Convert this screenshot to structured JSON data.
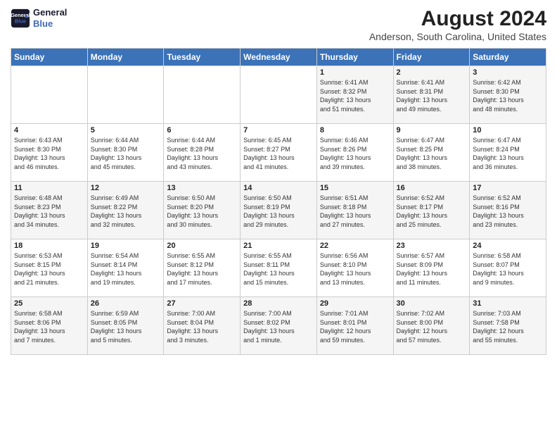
{
  "header": {
    "logo_line1": "General",
    "logo_line2": "Blue",
    "title": "August 2024",
    "subtitle": "Anderson, South Carolina, United States"
  },
  "days_of_week": [
    "Sunday",
    "Monday",
    "Tuesday",
    "Wednesday",
    "Thursday",
    "Friday",
    "Saturday"
  ],
  "weeks": [
    [
      {
        "day": "",
        "info": ""
      },
      {
        "day": "",
        "info": ""
      },
      {
        "day": "",
        "info": ""
      },
      {
        "day": "",
        "info": ""
      },
      {
        "day": "1",
        "info": "Sunrise: 6:41 AM\nSunset: 8:32 PM\nDaylight: 13 hours\nand 51 minutes."
      },
      {
        "day": "2",
        "info": "Sunrise: 6:41 AM\nSunset: 8:31 PM\nDaylight: 13 hours\nand 49 minutes."
      },
      {
        "day": "3",
        "info": "Sunrise: 6:42 AM\nSunset: 8:30 PM\nDaylight: 13 hours\nand 48 minutes."
      }
    ],
    [
      {
        "day": "4",
        "info": "Sunrise: 6:43 AM\nSunset: 8:30 PM\nDaylight: 13 hours\nand 46 minutes."
      },
      {
        "day": "5",
        "info": "Sunrise: 6:44 AM\nSunset: 8:30 PM\nDaylight: 13 hours\nand 45 minutes."
      },
      {
        "day": "6",
        "info": "Sunrise: 6:44 AM\nSunset: 8:28 PM\nDaylight: 13 hours\nand 43 minutes."
      },
      {
        "day": "7",
        "info": "Sunrise: 6:45 AM\nSunset: 8:27 PM\nDaylight: 13 hours\nand 41 minutes."
      },
      {
        "day": "8",
        "info": "Sunrise: 6:46 AM\nSunset: 8:26 PM\nDaylight: 13 hours\nand 39 minutes."
      },
      {
        "day": "9",
        "info": "Sunrise: 6:47 AM\nSunset: 8:25 PM\nDaylight: 13 hours\nand 38 minutes."
      },
      {
        "day": "10",
        "info": "Sunrise: 6:47 AM\nSunset: 8:24 PM\nDaylight: 13 hours\nand 36 minutes."
      }
    ],
    [
      {
        "day": "11",
        "info": "Sunrise: 6:48 AM\nSunset: 8:23 PM\nDaylight: 13 hours\nand 34 minutes."
      },
      {
        "day": "12",
        "info": "Sunrise: 6:49 AM\nSunset: 8:22 PM\nDaylight: 13 hours\nand 32 minutes."
      },
      {
        "day": "13",
        "info": "Sunrise: 6:50 AM\nSunset: 8:20 PM\nDaylight: 13 hours\nand 30 minutes."
      },
      {
        "day": "14",
        "info": "Sunrise: 6:50 AM\nSunset: 8:19 PM\nDaylight: 13 hours\nand 29 minutes."
      },
      {
        "day": "15",
        "info": "Sunrise: 6:51 AM\nSunset: 8:18 PM\nDaylight: 13 hours\nand 27 minutes."
      },
      {
        "day": "16",
        "info": "Sunrise: 6:52 AM\nSunset: 8:17 PM\nDaylight: 13 hours\nand 25 minutes."
      },
      {
        "day": "17",
        "info": "Sunrise: 6:52 AM\nSunset: 8:16 PM\nDaylight: 13 hours\nand 23 minutes."
      }
    ],
    [
      {
        "day": "18",
        "info": "Sunrise: 6:53 AM\nSunset: 8:15 PM\nDaylight: 13 hours\nand 21 minutes."
      },
      {
        "day": "19",
        "info": "Sunrise: 6:54 AM\nSunset: 8:14 PM\nDaylight: 13 hours\nand 19 minutes."
      },
      {
        "day": "20",
        "info": "Sunrise: 6:55 AM\nSunset: 8:12 PM\nDaylight: 13 hours\nand 17 minutes."
      },
      {
        "day": "21",
        "info": "Sunrise: 6:55 AM\nSunset: 8:11 PM\nDaylight: 13 hours\nand 15 minutes."
      },
      {
        "day": "22",
        "info": "Sunrise: 6:56 AM\nSunset: 8:10 PM\nDaylight: 13 hours\nand 13 minutes."
      },
      {
        "day": "23",
        "info": "Sunrise: 6:57 AM\nSunset: 8:09 PM\nDaylight: 13 hours\nand 11 minutes."
      },
      {
        "day": "24",
        "info": "Sunrise: 6:58 AM\nSunset: 8:07 PM\nDaylight: 13 hours\nand 9 minutes."
      }
    ],
    [
      {
        "day": "25",
        "info": "Sunrise: 6:58 AM\nSunset: 8:06 PM\nDaylight: 13 hours\nand 7 minutes."
      },
      {
        "day": "26",
        "info": "Sunrise: 6:59 AM\nSunset: 8:05 PM\nDaylight: 13 hours\nand 5 minutes."
      },
      {
        "day": "27",
        "info": "Sunrise: 7:00 AM\nSunset: 8:04 PM\nDaylight: 13 hours\nand 3 minutes."
      },
      {
        "day": "28",
        "info": "Sunrise: 7:00 AM\nSunset: 8:02 PM\nDaylight: 13 hours\nand 1 minute."
      },
      {
        "day": "29",
        "info": "Sunrise: 7:01 AM\nSunset: 8:01 PM\nDaylight: 12 hours\nand 59 minutes."
      },
      {
        "day": "30",
        "info": "Sunrise: 7:02 AM\nSunset: 8:00 PM\nDaylight: 12 hours\nand 57 minutes."
      },
      {
        "day": "31",
        "info": "Sunrise: 7:03 AM\nSunset: 7:58 PM\nDaylight: 12 hours\nand 55 minutes."
      }
    ]
  ]
}
